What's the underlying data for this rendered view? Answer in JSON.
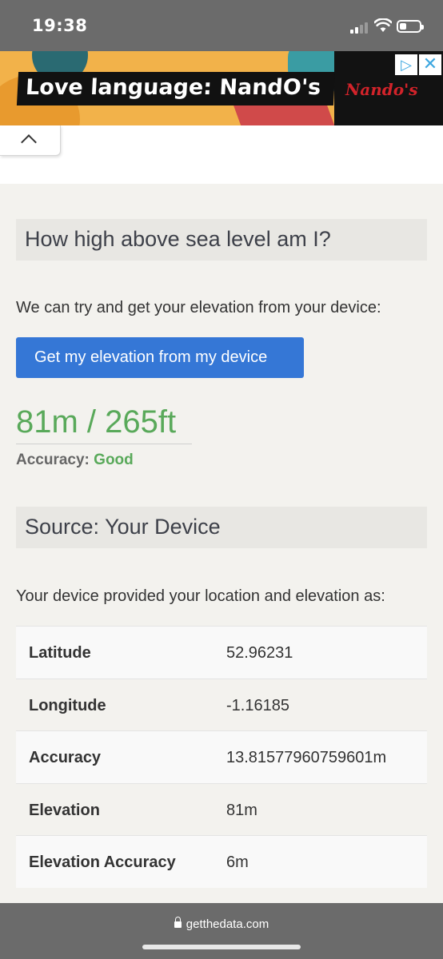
{
  "status_bar": {
    "time": "19:38"
  },
  "ad": {
    "headline": "Love language: NandO's",
    "brand": "Nando's",
    "choices_icon": "ad-choices-icon",
    "close_icon": "close-icon"
  },
  "main": {
    "title": "How high above sea level am I?",
    "intro": "We can try and get your elevation from your device:",
    "button_label": "Get my elevation from my device",
    "elevation_result": "81m / 265ft",
    "accuracy_label": "Accuracy:",
    "accuracy_value": "Good"
  },
  "source": {
    "title": "Source: Your Device",
    "description": "Your device provided your location and elevation as:",
    "rows": [
      {
        "label": "Latitude",
        "value": "52.96231"
      },
      {
        "label": "Longitude",
        "value": "-1.16185"
      },
      {
        "label": "Accuracy",
        "value": "13.81577960759601m"
      },
      {
        "label": "Elevation",
        "value": "81m"
      },
      {
        "label": "Elevation Accuracy",
        "value": "6m"
      }
    ]
  },
  "browser": {
    "url": "getthedata.com"
  },
  "colors": {
    "accent": "#3577d6",
    "success": "#59a95a"
  }
}
